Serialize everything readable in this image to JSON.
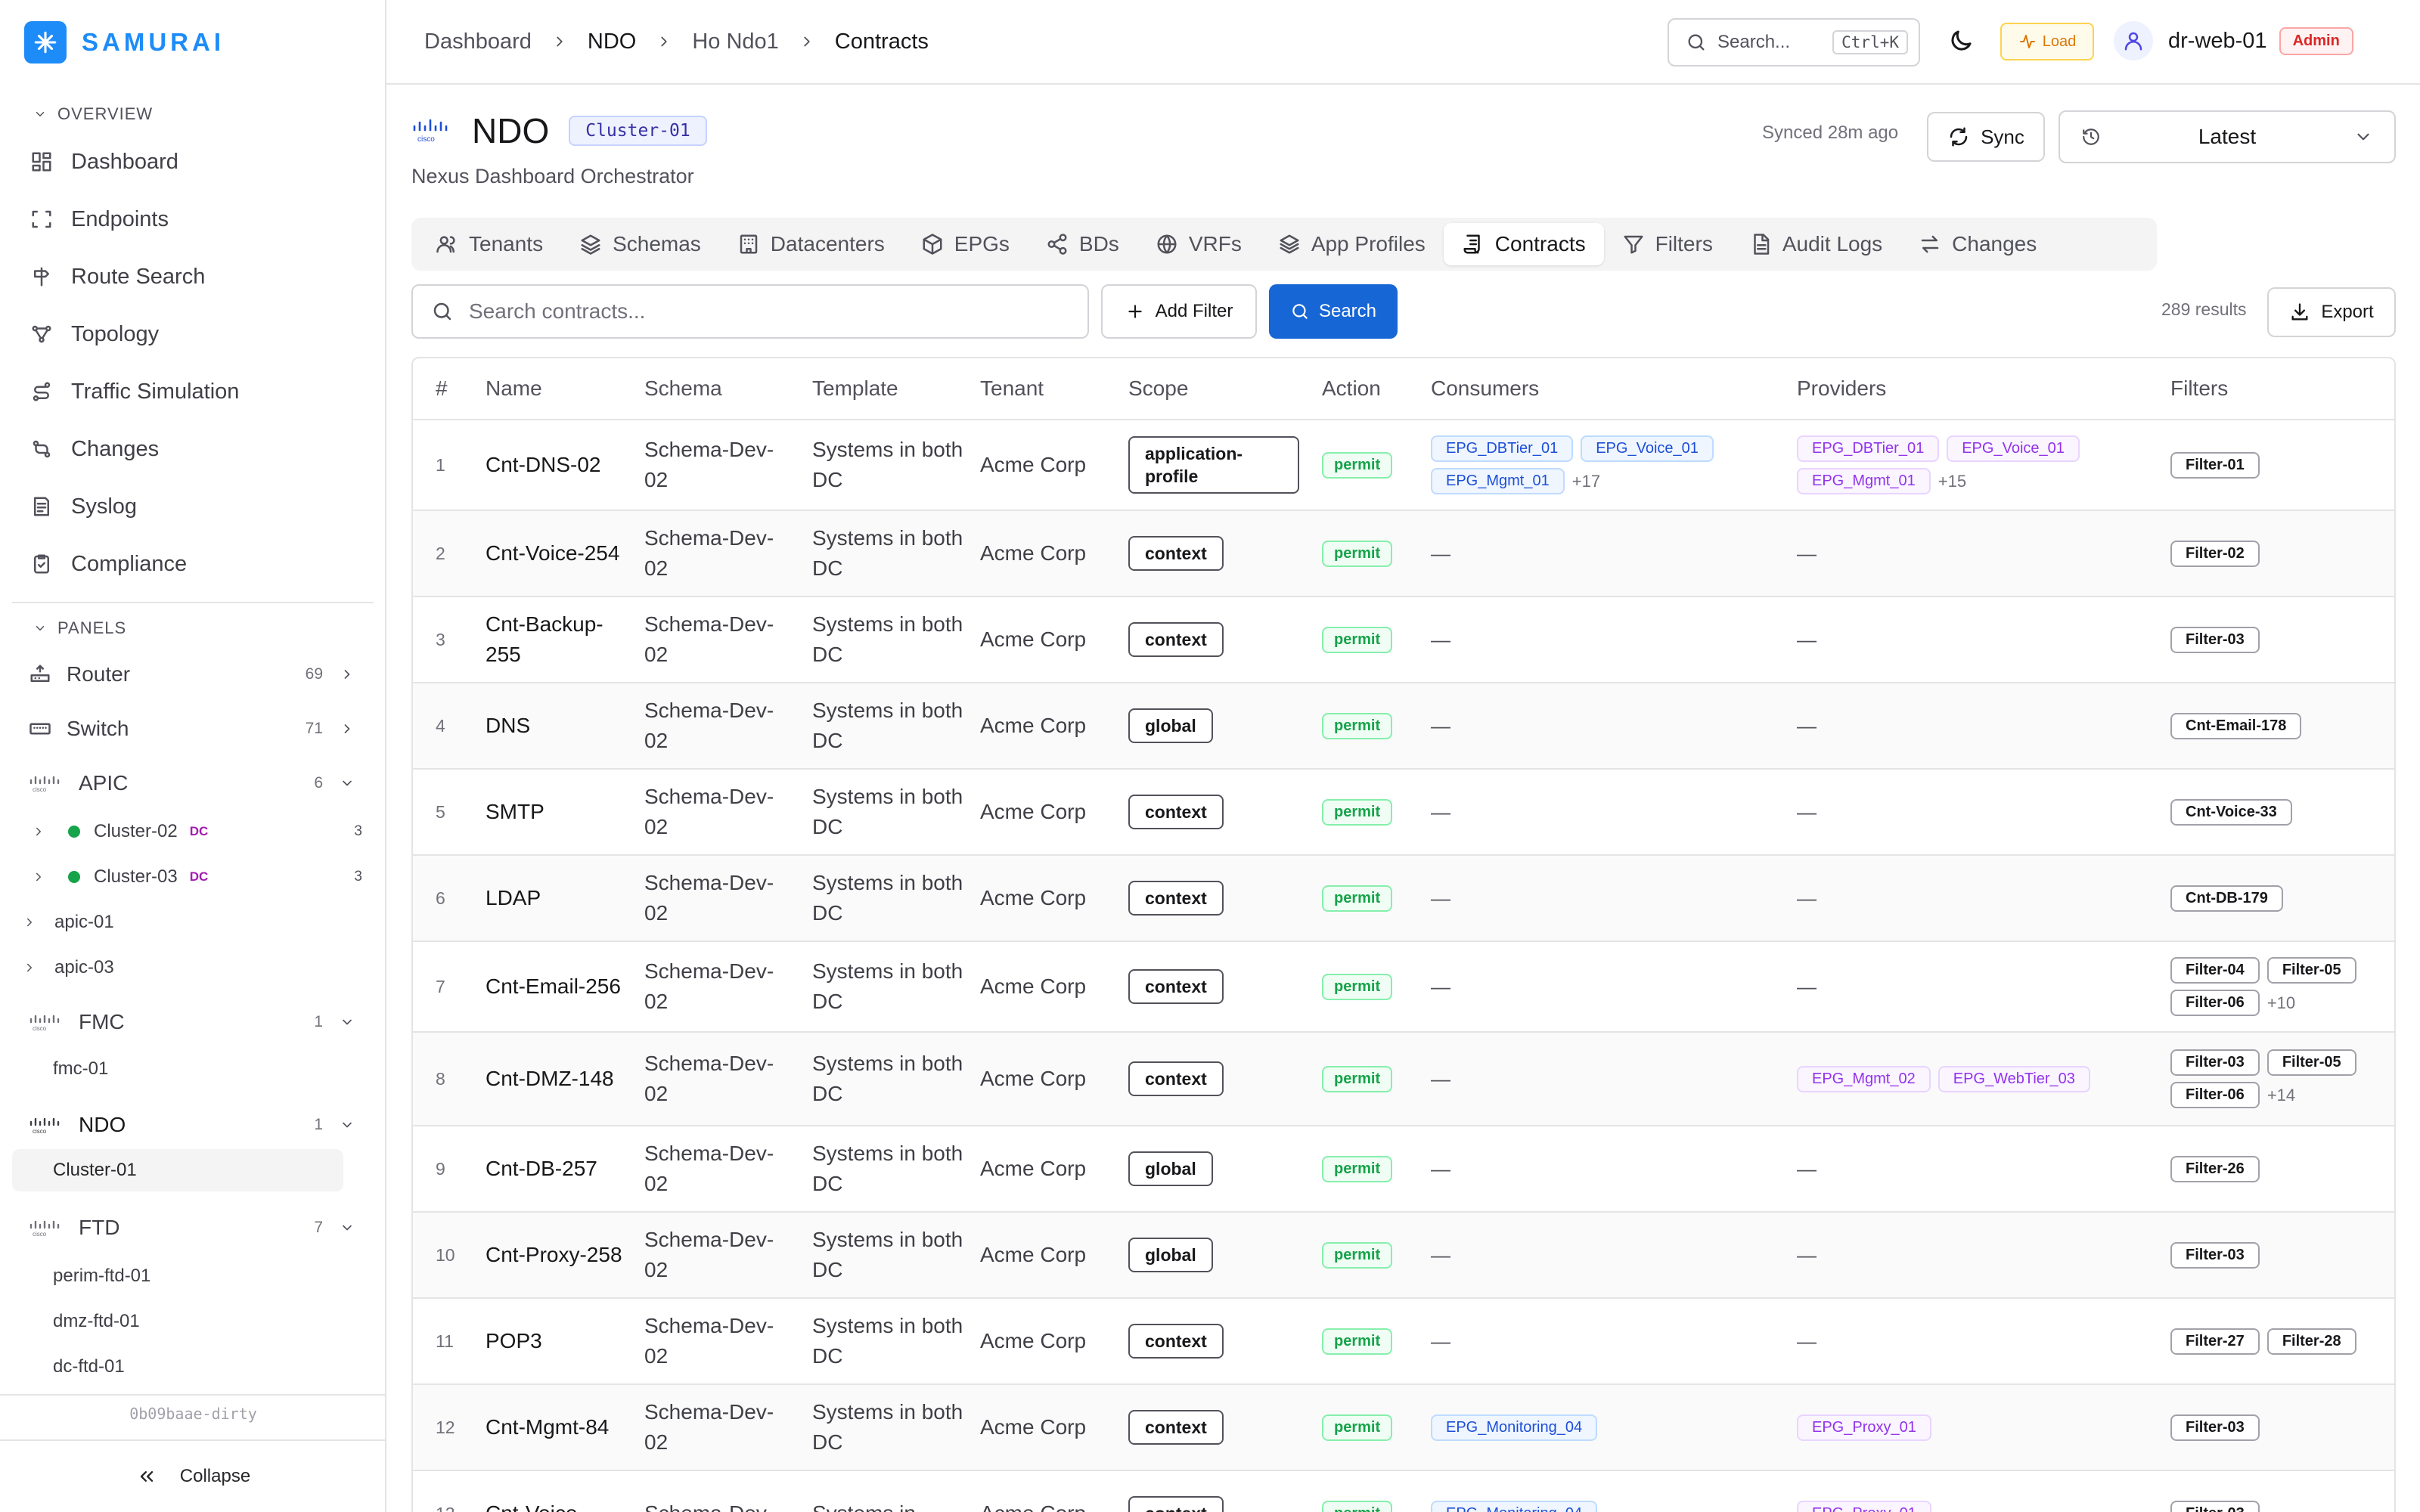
{
  "brand": {
    "name": "SAMURAI"
  },
  "sidebar": {
    "overview_title": "OVERVIEW",
    "nav": [
      {
        "label": "Dashboard",
        "icon": "dashboard-icon"
      },
      {
        "label": "Endpoints",
        "icon": "endpoints-icon"
      },
      {
        "label": "Route Search",
        "icon": "route-icon"
      },
      {
        "label": "Topology",
        "icon": "topology-icon"
      },
      {
        "label": "Traffic Simulation",
        "icon": "traffic-icon"
      },
      {
        "label": "Changes",
        "icon": "changes-icon"
      },
      {
        "label": "Syslog",
        "icon": "syslog-icon"
      },
      {
        "label": "Compliance",
        "icon": "compliance-icon"
      }
    ],
    "panels_title": "PANELS",
    "panels": {
      "router": {
        "label": "Router",
        "count": "69"
      },
      "switch": {
        "label": "Switch",
        "count": "71"
      },
      "apic": {
        "label": "APIC",
        "count": "6"
      },
      "fmc": {
        "label": "FMC",
        "count": "1"
      },
      "ndo": {
        "label": "NDO",
        "count": "1"
      },
      "ftd": {
        "label": "FTD",
        "count": "7"
      }
    },
    "apic_clusters": [
      {
        "label": "Cluster-02",
        "tag": "DC",
        "count": "3"
      },
      {
        "label": "Cluster-03",
        "tag": "DC",
        "count": "3"
      }
    ],
    "apic_hosts": [
      "apic-01",
      "apic-03"
    ],
    "fmc_items": [
      "fmc-01"
    ],
    "ndo_items": [
      "Cluster-01"
    ],
    "ftd_items": [
      "perim-ftd-01",
      "dmz-ftd-01",
      "dc-ftd-01"
    ],
    "commit": "0b09baae-dirty",
    "collapse_label": "Collapse"
  },
  "topbar": {
    "breadcrumbs": [
      "Dashboard",
      "NDO",
      "Ho Ndo1",
      "Contracts"
    ],
    "search_label": "Search...",
    "search_kbd": "Ctrl+K",
    "load_label": "Load",
    "user": "dr-web-01",
    "role": "Admin"
  },
  "page": {
    "title": "NDO",
    "cluster_badge": "Cluster-01",
    "subtitle": "Nexus Dashboard Orchestrator",
    "synced": "Synced 28m ago",
    "sync_label": "Sync",
    "version": "Latest"
  },
  "tabs": [
    {
      "label": "Tenants",
      "icon": "users-icon"
    },
    {
      "label": "Schemas",
      "icon": "layers-icon"
    },
    {
      "label": "Datacenters",
      "icon": "building-icon"
    },
    {
      "label": "EPGs",
      "icon": "cube-icon"
    },
    {
      "label": "BDs",
      "icon": "share-icon"
    },
    {
      "label": "VRFs",
      "icon": "globe-icon"
    },
    {
      "label": "App Profiles",
      "icon": "stack-icon"
    },
    {
      "label": "Contracts",
      "icon": "contract-icon"
    },
    {
      "label": "Filters",
      "icon": "funnel-icon"
    },
    {
      "label": "Audit Logs",
      "icon": "file-icon"
    },
    {
      "label": "Changes",
      "icon": "swap-icon"
    }
  ],
  "active_tab": "Contracts",
  "toolbar": {
    "search_placeholder": "Search contracts...",
    "add_filter": "Add Filter",
    "search_button": "Search",
    "results": "289 results",
    "export": "Export"
  },
  "table": {
    "columns": [
      "#",
      "Name",
      "Schema",
      "Template",
      "Tenant",
      "Scope",
      "Action",
      "Consumers",
      "Providers",
      "Filters"
    ],
    "rows": [
      {
        "num": "1",
        "name": "Cnt-DNS-02",
        "schema": "Schema-Dev-02",
        "template": "Systems in both DC",
        "tenant": "Acme Corp",
        "scope": "application-profile",
        "action": "permit",
        "consumers": [
          "EPG_DBTier_01",
          "EPG_Voice_01",
          "EPG_Mgmt_01"
        ],
        "consumers_more": "+17",
        "providers": [
          "EPG_DBTier_01",
          "EPG_Voice_01",
          "EPG_Mgmt_01"
        ],
        "providers_more": "+15",
        "filters": [
          "Filter-01"
        ],
        "filters_more": ""
      },
      {
        "num": "2",
        "name": "Cnt-Voice-254",
        "schema": "Schema-Dev-02",
        "template": "Systems in both DC",
        "tenant": "Acme Corp",
        "scope": "context",
        "action": "permit",
        "consumers": [],
        "consumers_more": "",
        "providers": [],
        "providers_more": "",
        "filters": [
          "Filter-02"
        ],
        "filters_more": ""
      },
      {
        "num": "3",
        "name": "Cnt-Backup-255",
        "schema": "Schema-Dev-02",
        "template": "Systems in both DC",
        "tenant": "Acme Corp",
        "scope": "context",
        "action": "permit",
        "consumers": [],
        "consumers_more": "",
        "providers": [],
        "providers_more": "",
        "filters": [
          "Filter-03"
        ],
        "filters_more": ""
      },
      {
        "num": "4",
        "name": "DNS",
        "schema": "Schema-Dev-02",
        "template": "Systems in both DC",
        "tenant": "Acme Corp",
        "scope": "global",
        "action": "permit",
        "consumers": [],
        "consumers_more": "",
        "providers": [],
        "providers_more": "",
        "filters": [
          "Cnt-Email-178"
        ],
        "filters_more": ""
      },
      {
        "num": "5",
        "name": "SMTP",
        "schema": "Schema-Dev-02",
        "template": "Systems in both DC",
        "tenant": "Acme Corp",
        "scope": "context",
        "action": "permit",
        "consumers": [],
        "consumers_more": "",
        "providers": [],
        "providers_more": "",
        "filters": [
          "Cnt-Voice-33"
        ],
        "filters_more": ""
      },
      {
        "num": "6",
        "name": "LDAP",
        "schema": "Schema-Dev-02",
        "template": "Systems in both DC",
        "tenant": "Acme Corp",
        "scope": "context",
        "action": "permit",
        "consumers": [],
        "consumers_more": "",
        "providers": [],
        "providers_more": "",
        "filters": [
          "Cnt-DB-179"
        ],
        "filters_more": ""
      },
      {
        "num": "7",
        "name": "Cnt-Email-256",
        "schema": "Schema-Dev-02",
        "template": "Systems in both DC",
        "tenant": "Acme Corp",
        "scope": "context",
        "action": "permit",
        "consumers": [],
        "consumers_more": "",
        "providers": [],
        "providers_more": "",
        "filters": [
          "Filter-04",
          "Filter-05",
          "Filter-06"
        ],
        "filters_more": "+10"
      },
      {
        "num": "8",
        "name": "Cnt-DMZ-148",
        "schema": "Schema-Dev-02",
        "template": "Systems in both DC",
        "tenant": "Acme Corp",
        "scope": "context",
        "action": "permit",
        "consumers": [],
        "consumers_more": "",
        "providers": [
          "EPG_Mgmt_02",
          "EPG_WebTier_03"
        ],
        "providers_more": "",
        "filters": [
          "Filter-03",
          "Filter-05",
          "Filter-06"
        ],
        "filters_more": "+14"
      },
      {
        "num": "9",
        "name": "Cnt-DB-257",
        "schema": "Schema-Dev-02",
        "template": "Systems in both DC",
        "tenant": "Acme Corp",
        "scope": "global",
        "action": "permit",
        "consumers": [],
        "consumers_more": "",
        "providers": [],
        "providers_more": "",
        "filters": [
          "Filter-26"
        ],
        "filters_more": ""
      },
      {
        "num": "10",
        "name": "Cnt-Proxy-258",
        "schema": "Schema-Dev-02",
        "template": "Systems in both DC",
        "tenant": "Acme Corp",
        "scope": "global",
        "action": "permit",
        "consumers": [],
        "consumers_more": "",
        "providers": [],
        "providers_more": "",
        "filters": [
          "Filter-03"
        ],
        "filters_more": ""
      },
      {
        "num": "11",
        "name": "POP3",
        "schema": "Schema-Dev-02",
        "template": "Systems in both DC",
        "tenant": "Acme Corp",
        "scope": "context",
        "action": "permit",
        "consumers": [],
        "consumers_more": "",
        "providers": [],
        "providers_more": "",
        "filters": [
          "Filter-27",
          "Filter-28"
        ],
        "filters_more": ""
      },
      {
        "num": "12",
        "name": "Cnt-Mgmt-84",
        "schema": "Schema-Dev-02",
        "template": "Systems in both DC",
        "tenant": "Acme Corp",
        "scope": "context",
        "action": "permit",
        "consumers": [
          "EPG_Monitoring_04"
        ],
        "consumers_more": "",
        "providers": [
          "EPG_Proxy_01"
        ],
        "providers_more": "",
        "filters": [
          "Filter-03"
        ],
        "filters_more": ""
      },
      {
        "num": "13",
        "name": "Cnt-Voice-",
        "schema": "Schema-Dev-",
        "template": "Systems in",
        "tenant": "Acme Corp",
        "scope": "context",
        "action": "permit",
        "consumers": [
          "EPG_Monitoring_04"
        ],
        "consumers_more": "",
        "providers": [
          "EPG_Proxy_01"
        ],
        "providers_more": "",
        "filters": [
          "Filter-03"
        ],
        "filters_more": ""
      }
    ],
    "empty_mark": "—"
  },
  "colors": {
    "accent": "#1d8cf8",
    "primary_button": "#1766d6",
    "permit": "#16a34a",
    "admin": "#dc2626"
  }
}
